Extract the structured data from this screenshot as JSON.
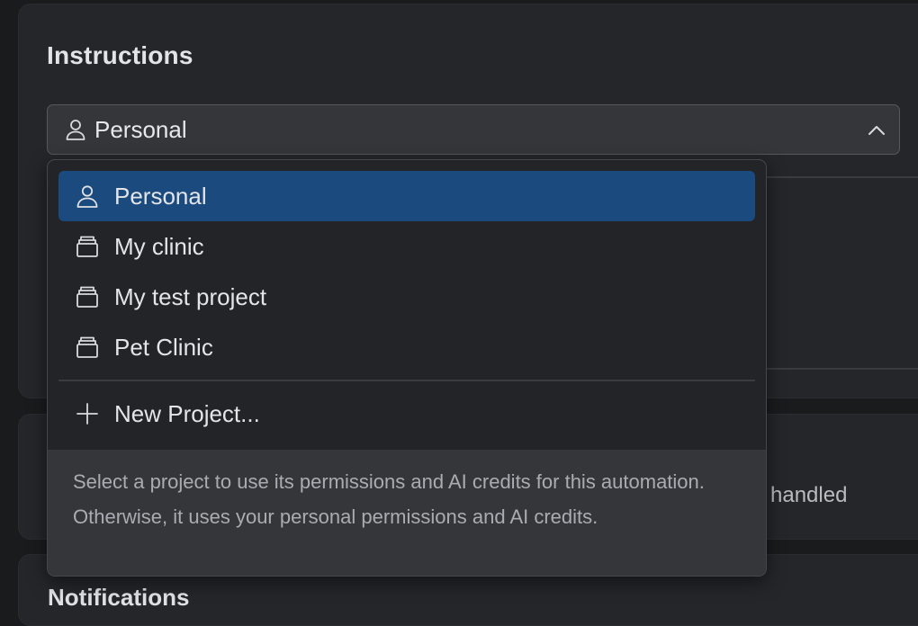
{
  "section": {
    "title": "Instructions"
  },
  "select": {
    "value": "Personal",
    "value_icon": "person-icon",
    "toggle_icon": "chevron-up-icon"
  },
  "dropdown": {
    "options": [
      {
        "label": "Personal",
        "icon": "person-icon",
        "selected": true
      },
      {
        "label": "My clinic",
        "icon": "project-icon",
        "selected": false
      },
      {
        "label": "My test project",
        "icon": "project-icon",
        "selected": false
      },
      {
        "label": "Pet Clinic",
        "icon": "project-icon",
        "selected": false
      }
    ],
    "new_project": {
      "label": "New Project...",
      "icon": "plus-icon"
    },
    "footer_text": "Select a project to use its permissions and AI credits for this automation. Otherwise, it uses your personal permissions and AI credits."
  },
  "background": {
    "peek_text": "handled",
    "third_title": "Notifications"
  },
  "colors": {
    "selected_bg": "#1b4a7e",
    "panel_bg": "#252629",
    "page_bg": "#1a1b1d",
    "trigger_bg": "#35363a"
  }
}
